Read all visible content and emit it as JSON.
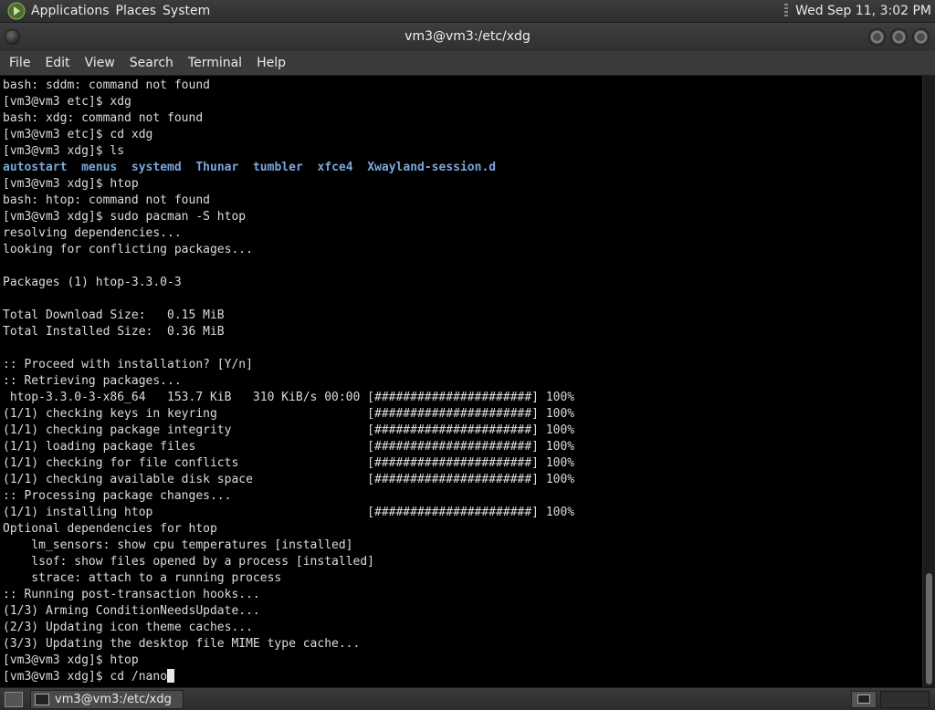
{
  "top_panel": {
    "menus": [
      "Applications",
      "Places",
      "System"
    ],
    "clock": "Wed Sep 11,  3:02 PM"
  },
  "window": {
    "title": "vm3@vm3:/etc/xdg",
    "menus": [
      "File",
      "Edit",
      "View",
      "Search",
      "Terminal",
      "Help"
    ]
  },
  "terminal": {
    "lines": [
      "bash: sddm: command not found",
      "[vm3@vm3 etc]$ xdg",
      "bash: xdg: command not found",
      "[vm3@vm3 etc]$ cd xdg",
      "[vm3@vm3 xdg]$ ls",
      "__LS__",
      "[vm3@vm3 xdg]$ htop",
      "bash: htop: command not found",
      "[vm3@vm3 xdg]$ sudo pacman -S htop",
      "resolving dependencies...",
      "looking for conflicting packages...",
      "",
      "Packages (1) htop-3.3.0-3",
      "",
      "Total Download Size:   0.15 MiB",
      "Total Installed Size:  0.36 MiB",
      "",
      ":: Proceed with installation? [Y/n]",
      ":: Retrieving packages...",
      " htop-3.3.0-3-x86_64   153.7 KiB   310 KiB/s 00:00 [######################] 100%",
      "(1/1) checking keys in keyring                     [######################] 100%",
      "(1/1) checking package integrity                   [######################] 100%",
      "(1/1) loading package files                        [######################] 100%",
      "(1/1) checking for file conflicts                  [######################] 100%",
      "(1/1) checking available disk space                [######################] 100%",
      ":: Processing package changes...",
      "(1/1) installing htop                              [######################] 100%",
      "Optional dependencies for htop",
      "    lm_sensors: show cpu temperatures [installed]",
      "    lsof: show files opened by a process [installed]",
      "    strace: attach to a running process",
      ":: Running post-transaction hooks...",
      "(1/3) Arming ConditionNeedsUpdate...",
      "(2/3) Updating icon theme caches...",
      "(3/3) Updating the desktop file MIME type cache...",
      "[vm3@vm3 xdg]$ htop",
      "__PROMPT__"
    ],
    "ls_entries": [
      "autostart",
      "menus",
      "systemd",
      "Thunar",
      "tumbler",
      "xfce4",
      "Xwayland-session.d"
    ],
    "prompt": "[vm3@vm3 xdg]$ ",
    "current_input": "cd /nano",
    "dir_color": "#7aa6da"
  },
  "bottom_panel": {
    "task_title": "vm3@vm3:/etc/xdg"
  }
}
